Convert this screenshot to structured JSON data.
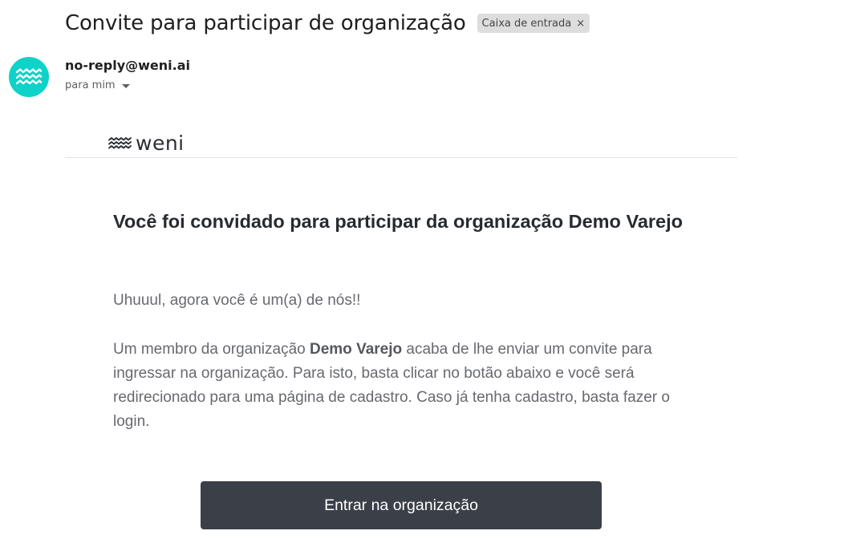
{
  "email": {
    "subject": "Convite para participar de organização",
    "label": "Caixa de entrada",
    "label_remove_glyph": "×",
    "sender": "no-reply@weni.ai",
    "recipient_text": "para mim",
    "avatar_color": "#0fd2c8"
  },
  "message": {
    "brand_name": "weni",
    "headline": "Você foi convidado para participar da organização Demo Varejo",
    "greeting": "Uhuuul, agora você é um(a) de nós!!",
    "body_prefix": "Um membro da organização ",
    "body_org": "Demo Varejo",
    "body_suffix": " acaba de lhe enviar um convite para ingressar na organização. Para isto, basta clicar no botão abaixo e você será redirecionado para uma página de cadastro. Caso já tenha cadastro, basta fazer o login.",
    "cta_label": "Entrar na organização",
    "cta_color": "#3b3f48"
  }
}
